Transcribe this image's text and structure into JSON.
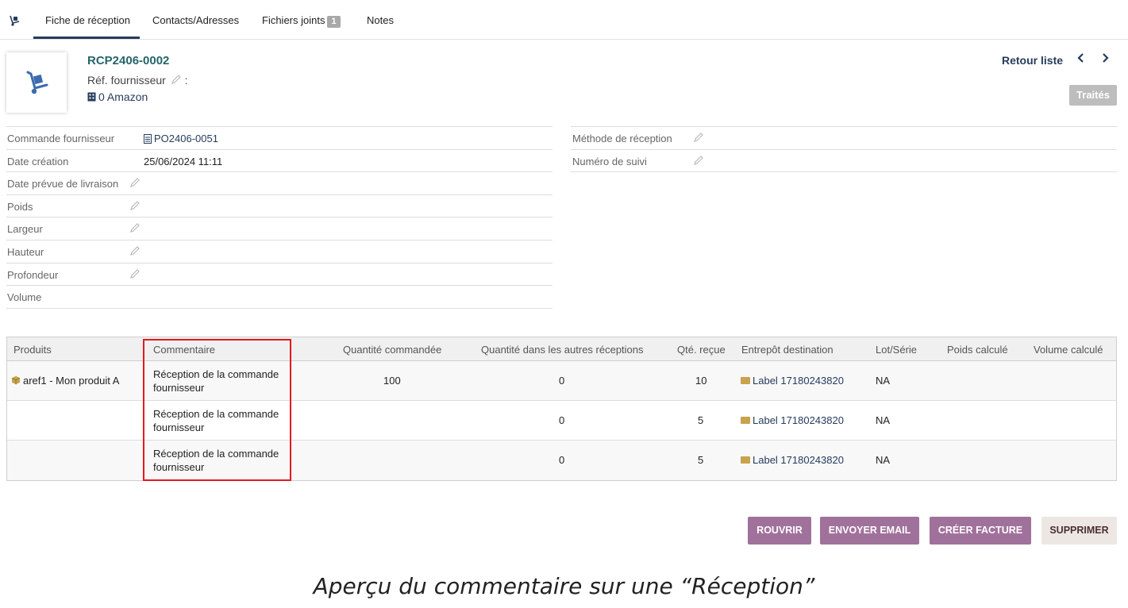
{
  "tabs": {
    "icon": "dolly-icon",
    "items": [
      {
        "label": "Fiche de réception"
      },
      {
        "label": "Contacts/Adresses"
      },
      {
        "label": "Fichiers joints",
        "badge": "1"
      },
      {
        "label": "Notes"
      }
    ]
  },
  "header": {
    "ref": "RCP2406-0002",
    "ref_supplier_label": "Réf. fournisseur",
    "ref_supplier_suffix": ":",
    "supplier": "0 Amazon",
    "back_label": "Retour liste",
    "prev": "‹",
    "next": "›",
    "status": "Traités"
  },
  "left_fields": [
    {
      "label": "Commande fournisseur",
      "value": "PO2406-0051"
    },
    {
      "label": "Date création",
      "value": "25/06/2024 11:11"
    },
    {
      "label": "Date prévue de livraison",
      "value": ""
    },
    {
      "label": "Poids",
      "value": ""
    },
    {
      "label": "Largeur",
      "value": ""
    },
    {
      "label": "Hauteur",
      "value": ""
    },
    {
      "label": "Profondeur",
      "value": ""
    },
    {
      "label": "Volume",
      "value": ""
    }
  ],
  "right_fields": [
    {
      "label": "Méthode de réception",
      "value": ""
    },
    {
      "label": "Numéro de suivi",
      "value": ""
    }
  ],
  "lines": {
    "headers": [
      "Produits",
      "Commentaire",
      "Quantité commandée",
      "Quantité dans les autres réceptions",
      "Qté. reçue",
      "Entrepôt destination",
      "Lot/Série",
      "Poids calculé",
      "Volume calculé"
    ],
    "rows": [
      {
        "product": "aref1 - Mon produit A",
        "comment": "Réception de la commande fournisseur",
        "qty_ordered": "100",
        "qty_other": "0",
        "qty_received": "10",
        "warehouse": "Label 17180243820",
        "lot": "NA"
      },
      {
        "product": "",
        "comment": "Réception de la commande fournisseur",
        "qty_ordered": "",
        "qty_other": "0",
        "qty_received": "5",
        "warehouse": "Label 17180243820",
        "lot": "NA"
      },
      {
        "product": "",
        "comment": "Réception de la commande fournisseur",
        "qty_ordered": "",
        "qty_other": "0",
        "qty_received": "5",
        "warehouse": "Label 17180243820",
        "lot": "NA"
      }
    ]
  },
  "actions": {
    "reopen": "ROUVRIR",
    "send_email": "ENVOYER EMAIL",
    "create_invoice": "CRÉER FACTURE",
    "delete": "SUPPRIMER"
  },
  "caption": "Aperçu du commentaire sur une “Réception”",
  "colors": {
    "accent": "#a0719b",
    "brand": "#263c5c",
    "ref": "#25656b",
    "highlight": "#e5191e"
  }
}
